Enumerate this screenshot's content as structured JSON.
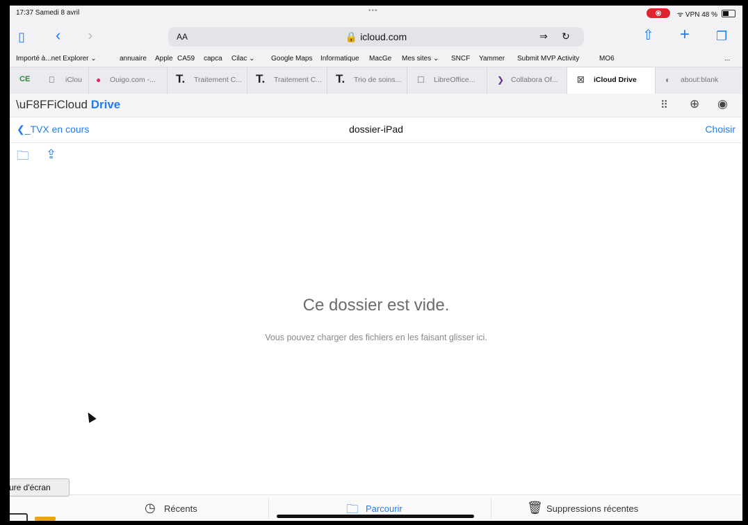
{
  "status": {
    "time_date": "17:37  Samedi 8 avril",
    "dots": "•••",
    "wifi_vpn_battery": "ᯤ VPN 48 %"
  },
  "toolbar": {
    "text_size": "AA",
    "url": "🔒 icloud.com"
  },
  "bookmarks": [
    "Importé à...net Explorer ⌄",
    "annuaire",
    "Apple",
    "CA59",
    "capca",
    "Cilac ⌄",
    "Google Maps",
    "Informatique",
    "MacGe",
    "Mes sites ⌄",
    "SNCF",
    "Yammer",
    "Submit MVP Activity",
    "MO6",
    "..."
  ],
  "tabs": [
    {
      "label": "iClou",
      "icon": ""
    },
    {
      "label": "Ouigo.com -...",
      "icon": "●"
    },
    {
      "label": "Traitement C...",
      "icon": "T."
    },
    {
      "label": "Traitement C...",
      "icon": "T."
    },
    {
      "label": "Trio de soins...",
      "icon": "T."
    },
    {
      "label": "LibreOffice...",
      "icon": "☐"
    },
    {
      "label": "Collabora Of...",
      "icon": "❯"
    },
    {
      "label": "iCloud Drive",
      "icon": "☒"
    },
    {
      "label": "about:blank",
      "icon": "◐"
    }
  ],
  "header": {
    "brand": "iCloud",
    "product": "Drive"
  },
  "nav": {
    "back_label": "_TVX en cours",
    "title": "dossier-iPad",
    "choose": "Choisir"
  },
  "empty": {
    "title": "Ce dossier est vide.",
    "subtitle": "Vous pouvez charger des fichiers en les faisant glisser ici."
  },
  "bottom": {
    "recents": "Récents",
    "browse": "Parcourir",
    "deleted": "Suppressions récentes"
  },
  "tooltip": "ure d'écran",
  "colors": {
    "accent": "#1f7cf0",
    "record": "#e0242e"
  }
}
